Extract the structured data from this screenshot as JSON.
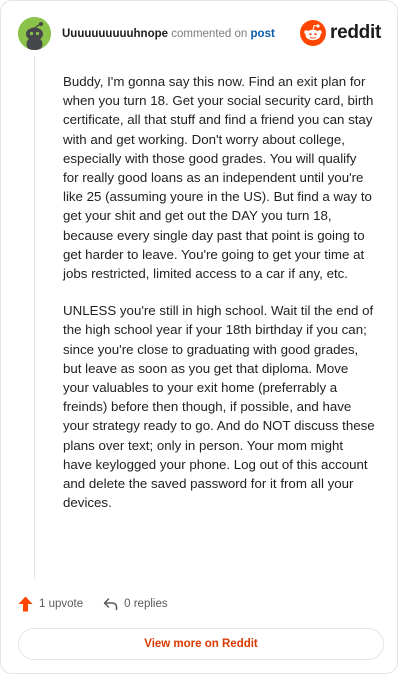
{
  "comment": {
    "username": "Uuuuuuuuuuhnope",
    "action_text": "commented on",
    "post_link_text": "post",
    "paragraphs": [
      "Buddy, I'm gonna say this now. Find an exit plan for when you turn 18. Get your social security card, birth certificate, all that stuff and find a friend you can stay with and get working. Don't worry about college, especially with those good grades. You will qualify for really good loans as an independent until you're like 25 (assuming youre in the US). But find a way to get your shit and get out the DAY you turn 18, because every single day past that point is going to get harder to leave. You're going to get your time at jobs restricted, limited access to a car if any, etc.",
      "UNLESS you're still in high school. Wait til the end of the high school year if your 18th birthday if you can; since you're close to graduating with good grades, but leave as soon as you get that diploma. Move your valuables to your exit home (preferrably a freinds) before then though, if possible, and have your strategy ready to go. And do NOT discuss these plans over text; only in person. Your mom might have keylogged your phone. Log out of this account and delete the saved password for it from all your devices."
    ]
  },
  "brand": {
    "logo_text": "reddit",
    "accent_color": "#ff4500"
  },
  "actions": {
    "upvote_label": "1 upvote",
    "replies_label": "0 replies",
    "upvote_icon": "upvote-arrow-icon",
    "reply_icon": "reply-arrow-icon"
  },
  "footer": {
    "view_more_label": "View more on Reddit"
  }
}
